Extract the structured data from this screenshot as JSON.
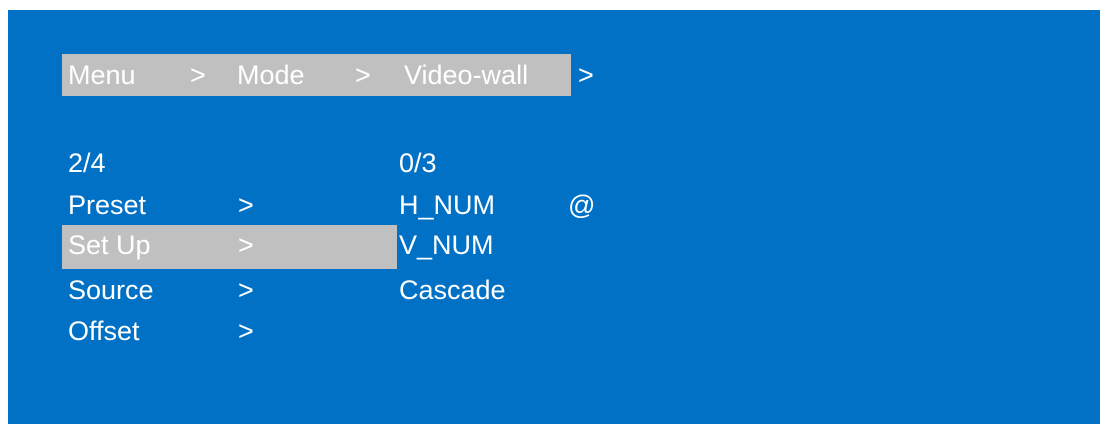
{
  "breadcrumb": {
    "items": [
      "Menu",
      "Mode",
      "Video-wall"
    ],
    "separator": ">",
    "trailing_arrow": ">"
  },
  "left_menu": {
    "page_indicator": "2/4",
    "selected_index": 1,
    "items": [
      {
        "label": "Preset",
        "arrow": ">"
      },
      {
        "label": "Set Up",
        "arrow": ">"
      },
      {
        "label": "Source",
        "arrow": ">"
      },
      {
        "label": "Offset",
        "arrow": ">"
      }
    ]
  },
  "right_menu": {
    "page_indicator": "0/3",
    "items": [
      {
        "label": "H_NUM",
        "marker": "@"
      },
      {
        "label": "V_NUM",
        "marker": ""
      },
      {
        "label": "Cascade",
        "marker": ""
      }
    ]
  },
  "colors": {
    "background": "#0071c5",
    "highlight": "#c0c0c0",
    "text": "#ffffff"
  }
}
